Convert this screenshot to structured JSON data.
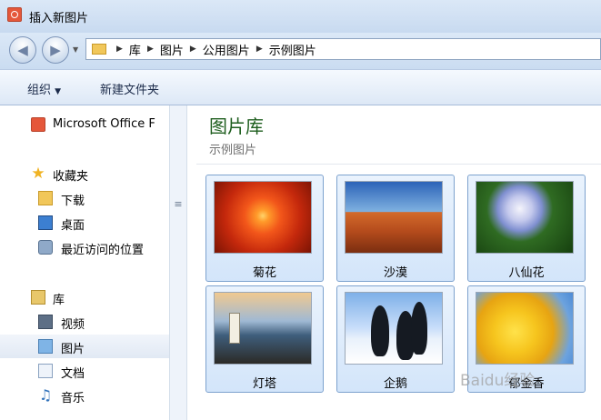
{
  "window": {
    "title": "插入新图片"
  },
  "navigation": {
    "breadcrumb": [
      "库",
      "图片",
      "公用图片",
      "示例图片"
    ]
  },
  "toolbar": {
    "organize_label": "组织",
    "new_folder_label": "新建文件夹"
  },
  "nav_pane": {
    "items": [
      {
        "label": "Microsoft Office F",
        "icon": "office-icon"
      },
      {
        "label": "收藏夹",
        "icon": "star-icon"
      },
      {
        "label": "下载",
        "icon": "folder-download-icon"
      },
      {
        "label": "桌面",
        "icon": "desktop-icon"
      },
      {
        "label": "最近访问的位置",
        "icon": "recent-places-icon"
      },
      {
        "label": "库",
        "icon": "library-icon"
      },
      {
        "label": "视频",
        "icon": "video-library-icon"
      },
      {
        "label": "图片",
        "icon": "pictures-library-icon",
        "selected": true
      },
      {
        "label": "文档",
        "icon": "documents-library-icon"
      },
      {
        "label": "音乐",
        "icon": "music-library-icon"
      }
    ]
  },
  "content": {
    "library_title": "图片库",
    "library_subtitle": "示例图片",
    "images": [
      {
        "name": "菊花"
      },
      {
        "name": "沙漠"
      },
      {
        "name": "八仙花"
      },
      {
        "name": "灯塔"
      },
      {
        "name": "企鹅"
      },
      {
        "name": "郁金香"
      }
    ]
  },
  "watermark": {
    "text": "Baidu经验"
  },
  "colors": {
    "library_title": "#1e5e1e",
    "selection_border": "#7da2ce",
    "selection_fill": "#d3e5fa"
  }
}
